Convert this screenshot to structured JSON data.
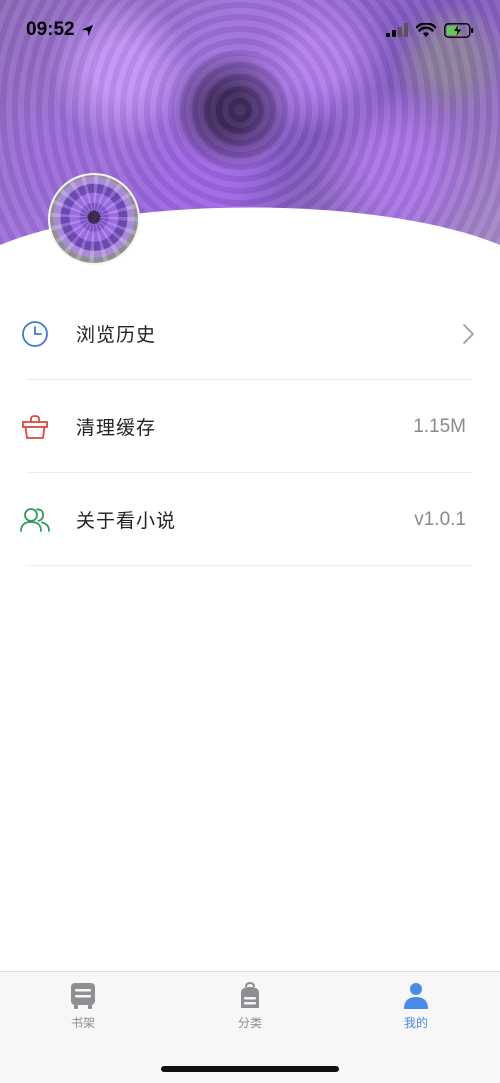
{
  "status_bar": {
    "time": "09:52"
  },
  "menu": {
    "items": [
      {
        "label": "浏览历史",
        "value": "",
        "icon": "clock-icon",
        "color": "#3e7bd6"
      },
      {
        "label": "清理缓存",
        "value": "1.15M",
        "icon": "basket-icon",
        "color": "#e0463b"
      },
      {
        "label": "关于看小说",
        "value": "v1.0.1",
        "icon": "users-icon",
        "color": "#2a9d55"
      }
    ]
  },
  "tab_bar": {
    "tabs": [
      {
        "label": "书架",
        "icon": "bookshelf-icon",
        "active": false
      },
      {
        "label": "分类",
        "icon": "backpack-icon",
        "active": false
      },
      {
        "label": "我的",
        "icon": "person-icon",
        "active": true
      }
    ],
    "active_color": "#4a8ae8",
    "inactive_color": "#8e8e93"
  }
}
